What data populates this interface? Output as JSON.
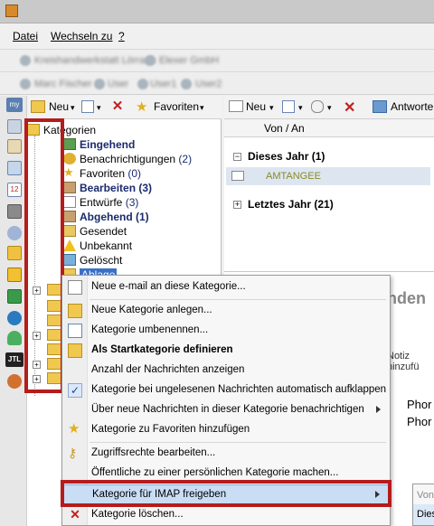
{
  "menu": [
    "Datei",
    "Wechseln zu",
    "?"
  ],
  "toolbar_blurred": [
    "Kreishandwerkstatt Lörrach",
    "Elexer GmbH"
  ],
  "users_blurred": [
    "Marc Fischer",
    "User",
    "User1",
    "User2"
  ],
  "tree_toolbar": {
    "neu": "Neu",
    "favoriten": "Favoriten"
  },
  "tree": {
    "root": "Kategorien",
    "items": [
      {
        "label": "Eingehend",
        "count": "",
        "bold": true
      },
      {
        "label": "Benachrichtigungen",
        "count": "(2)",
        "bold": false
      },
      {
        "label": "Favoriten",
        "count": "(0)",
        "bold": false
      },
      {
        "label": "Bearbeiten",
        "count": "(3)",
        "bold": true
      },
      {
        "label": "Entwürfe",
        "count": "(3)",
        "bold": false
      },
      {
        "label": "Abgehend",
        "count": "(1)",
        "bold": true
      },
      {
        "label": "Gesendet",
        "count": "",
        "bold": false
      },
      {
        "label": "Unbekannt",
        "count": "",
        "bold": false
      },
      {
        "label": "Gelöscht",
        "count": "",
        "bold": false
      },
      {
        "label": "Ablage",
        "count": "",
        "bold": false
      }
    ]
  },
  "right_toolbar": {
    "neu": "Neu",
    "antworten": "Antworten"
  },
  "right_pane": {
    "col_header": "Von / An",
    "group1": "Dieses Jahr (1)",
    "row1_sender": "AMTANGEE",
    "group2": "Letztes Jahr (21)",
    "partial_title": "nden",
    "notiz": "Notiz hinzufü",
    "phone1": "Phor",
    "phone2": "Phor"
  },
  "context_menu": [
    {
      "label": "Neue e-mail an diese Kategorie...",
      "icon": "mail-new-icon",
      "bold": false,
      "submenu": false,
      "checked": false
    },
    {
      "label": "Neue Kategorie anlegen...",
      "icon": "folder-new-icon",
      "bold": false,
      "submenu": false,
      "checked": false
    },
    {
      "label": "Kategorie umbenennen...",
      "icon": "rename-icon",
      "bold": false,
      "submenu": false,
      "checked": false
    },
    {
      "label": "Als Startkategorie definieren",
      "icon": "folder-start-icon",
      "bold": true,
      "submenu": false,
      "checked": false
    },
    {
      "label": "Anzahl der Nachrichten anzeigen",
      "icon": "",
      "bold": false,
      "submenu": false,
      "checked": false
    },
    {
      "label": "Kategorie bei ungelesenen Nachrichten automatisch aufklappen",
      "icon": "check-icon",
      "bold": false,
      "submenu": false,
      "checked": true
    },
    {
      "label": "Über neue Nachrichten in dieser Kategorie benachrichtigen",
      "icon": "",
      "bold": false,
      "submenu": true,
      "checked": false
    },
    {
      "label": "Kategorie zu Favoriten hinzufügen",
      "icon": "star-icon",
      "bold": false,
      "submenu": false,
      "checked": false
    },
    {
      "label": "Zugriffsrechte bearbeiten...",
      "icon": "key-icon",
      "bold": false,
      "submenu": false,
      "checked": false
    },
    {
      "label": "Öffentliche zu einer persönlichen Kategorie machen...",
      "icon": "",
      "bold": false,
      "submenu": false,
      "checked": false
    },
    {
      "label": "Kategorie für IMAP freigeben",
      "icon": "",
      "bold": false,
      "submenu": true,
      "checked": false,
      "highlighted": true
    },
    {
      "label": "Kategorie löschen...",
      "icon": "delete-icon",
      "bold": false,
      "submenu": false,
      "checked": false
    }
  ],
  "submenu_partial": {
    "item1": "Von",
    "item2": "Dies"
  },
  "colors": {
    "highlight": "#a8c8ee",
    "red_box": "#b51c1c",
    "bold_text": "#1a2a6c",
    "amtangee": "#8a8a2a"
  }
}
